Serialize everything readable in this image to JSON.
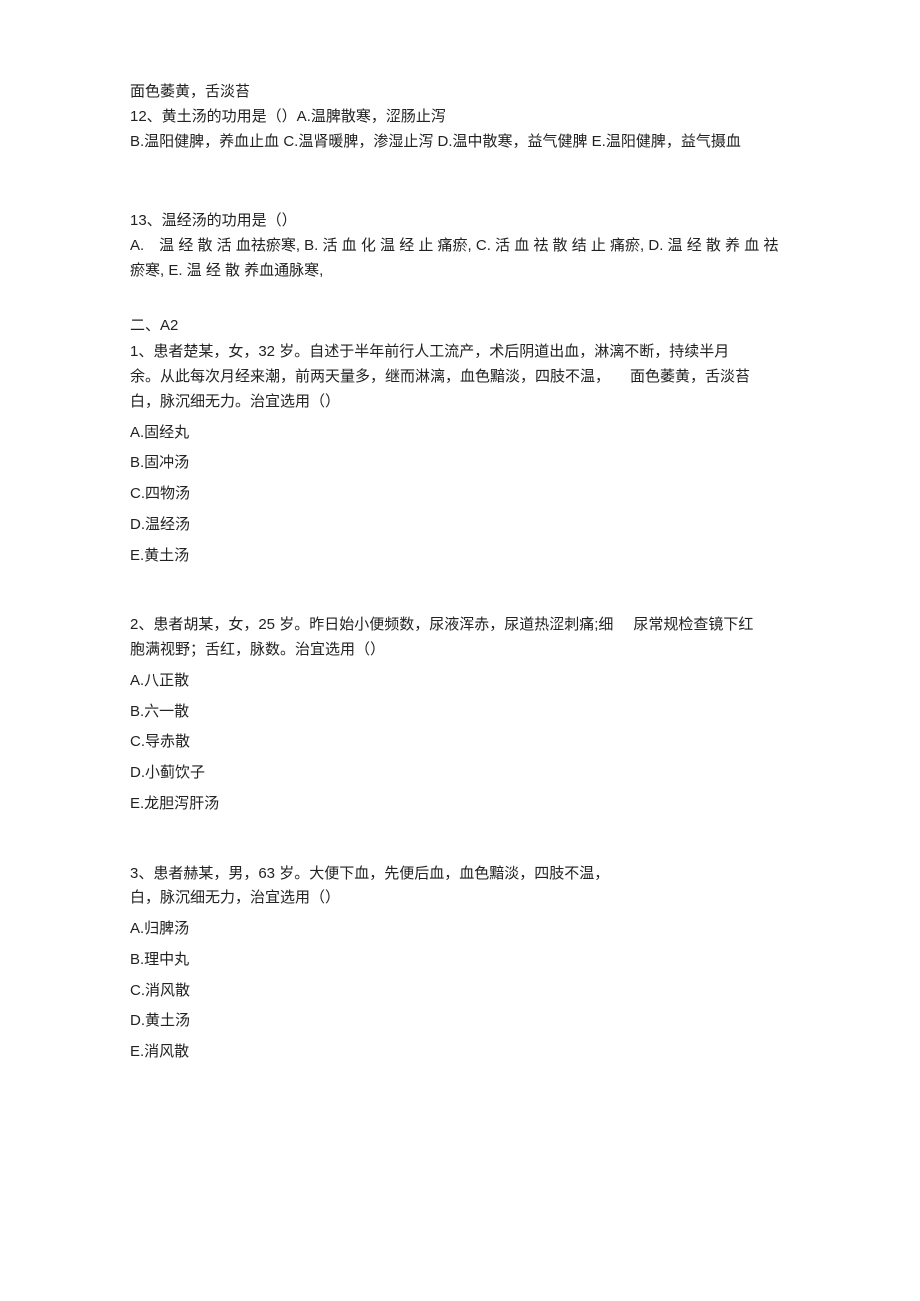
{
  "q11_trailing": "面色萎黄，舌淡苔",
  "q12": {
    "stem": "12、黄土汤的功用是（）A.温脾散寒，涩肠止泻",
    "b": "B.温阳健脾，养血止血 C.温肾暖脾，渗湿止泻 D.温中散寒，益气健脾 E.温阳健脾，益气摄血"
  },
  "q13": {
    "stem": "13、温经汤的功用是（）",
    "a": "A.　温 经 散 活 血祛瘀寒, B. 活 血 化 温 经 止 痛瘀, C. 活 血 祛 散 结 止 痛瘀, D. 温 经 散 养 血 祛 瘀寒, E. 温 经 散 养血通脉寒,"
  },
  "section2": "二、A2",
  "a2q1": {
    "stem_l1": "1、患者楚某，女，32 岁。自述于半年前行人工流产，术后阴道出血，淋漓不断，持续半月",
    "stem_l2a": "余。从此每次月经来潮，前两天量多，继而淋漓，血色黯淡，四肢不温，",
    "stem_l2b": "面色萎黄，舌淡苔",
    "stem_l3": "白，脉沉细无力。治宜选用（）",
    "a": "A.固经丸",
    "b": "B.固冲汤",
    "c": "C.四物汤",
    "d": "D.温经汤",
    "e": "E.黄土汤"
  },
  "a2q2": {
    "stem_l1a": "2、患者胡某，女，25 岁。昨日始小便频数，尿液浑赤，尿道热涩刺痛;细",
    "stem_l1b": "尿常规检查镜下红",
    "stem_l2": "胞满视野；舌红，脉数。治宜选用（）",
    "a": "A.八正散",
    "b": "B.六一散",
    "c": "C.导赤散",
    "d": "D.小蓟饮子",
    "e": "E.龙胆泻肝汤"
  },
  "a2q3": {
    "stem_l1": "3、患者赫某，男，63 岁。大便下血，先便后血，血色黯淡，四肢不温，",
    "stem_l2": "白，脉沉细无力，治宜选用（）",
    "a": "A.归脾汤",
    "b": "B.理中丸",
    "c": "C.消风散",
    "d": "D.黄土汤",
    "e": "E.消风散"
  }
}
